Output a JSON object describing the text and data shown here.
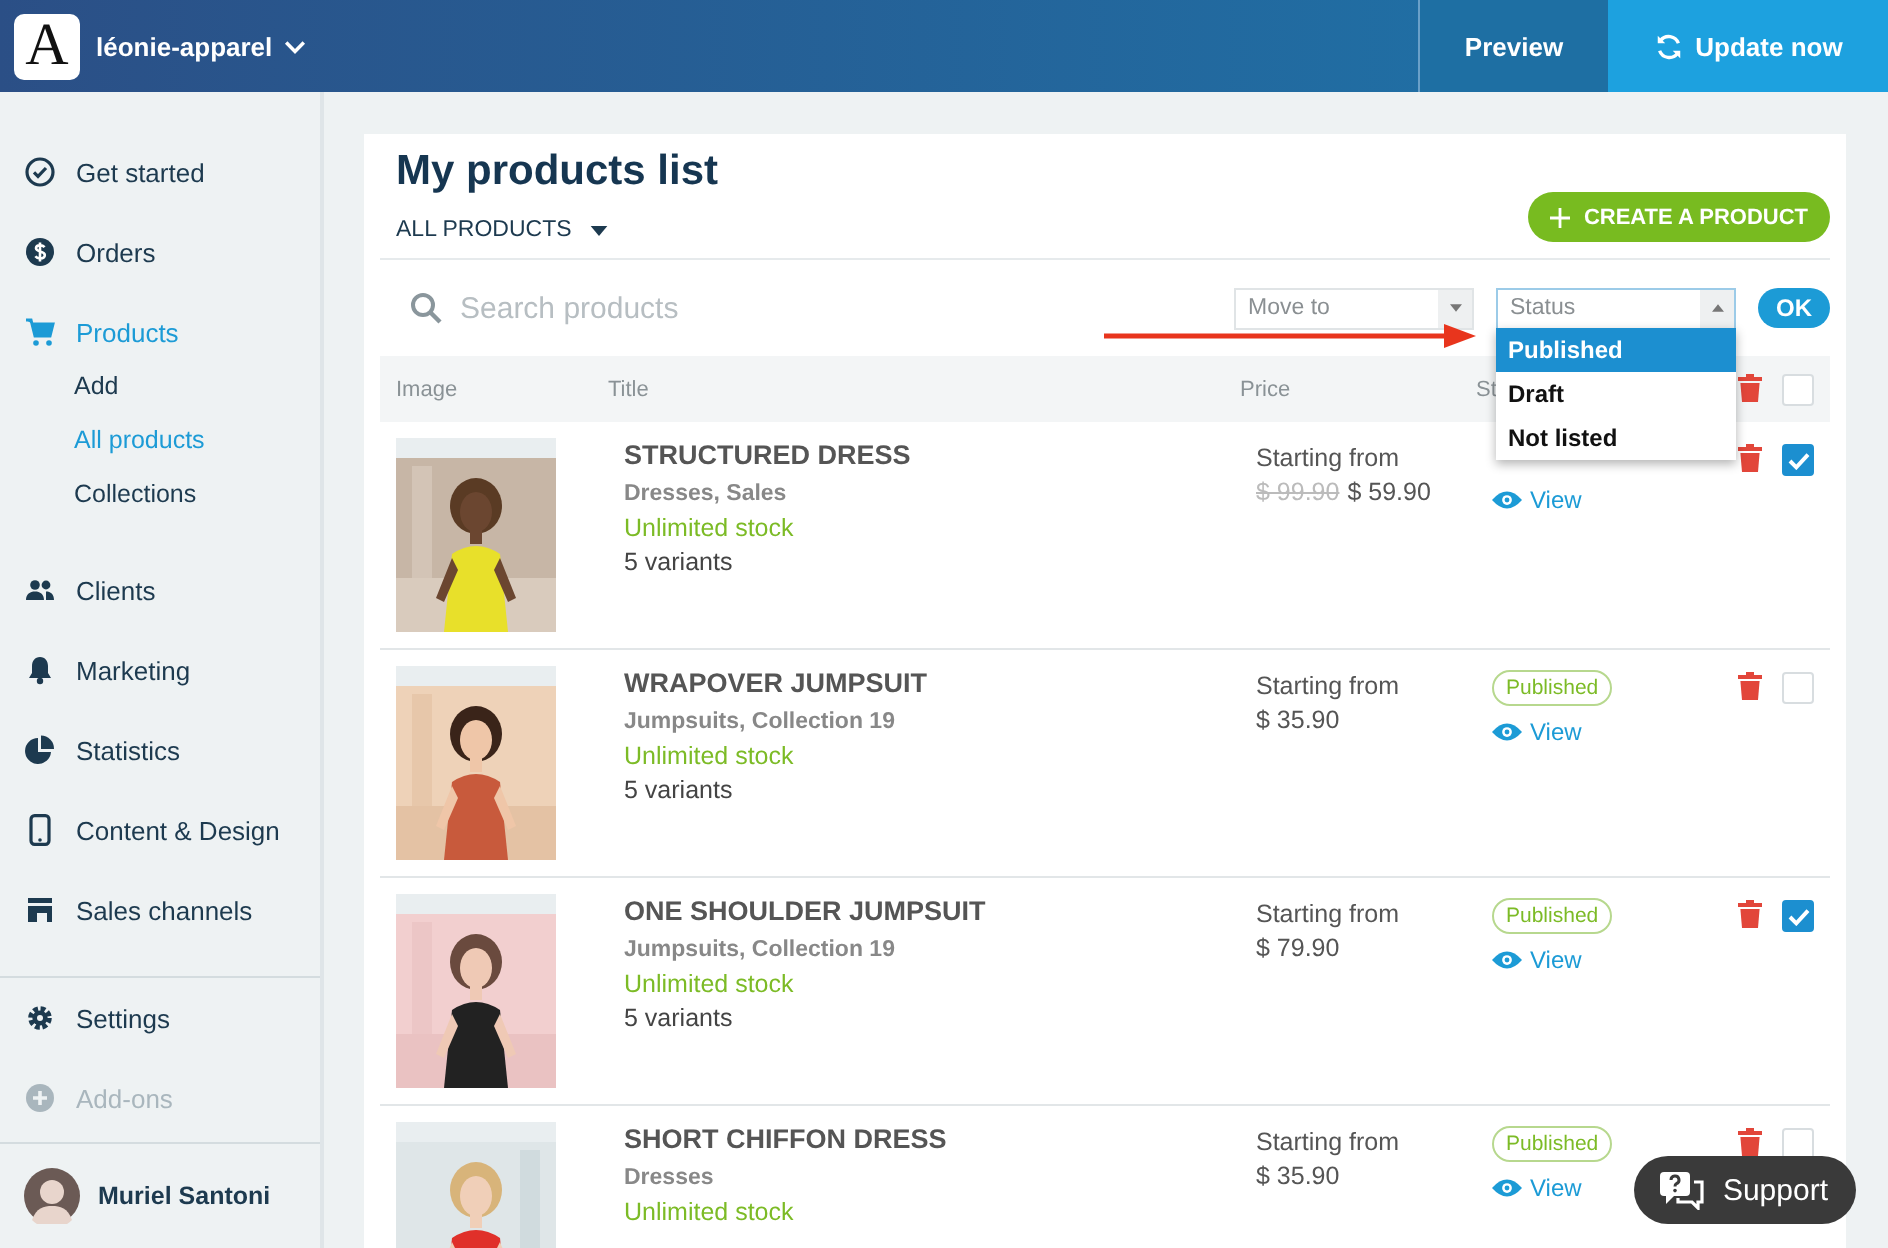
{
  "app": {
    "logo": "A",
    "store_name": "léonie-apparel"
  },
  "header_buttons": [
    {
      "label": "Preview",
      "kind": "plain"
    },
    {
      "label": "Update now",
      "kind": "primary"
    }
  ],
  "sidebar": {
    "items": [
      {
        "label": "Get started",
        "selected": false
      },
      {
        "label": "Orders",
        "selected": false
      },
      {
        "label": "Products",
        "selected": true,
        "children": [
          {
            "label": "Add",
            "selected": false
          },
          {
            "label": "All products",
            "selected": true
          },
          {
            "label": "Collections",
            "selected": false
          }
        ]
      },
      {
        "label": "Clients",
        "selected": false
      },
      {
        "label": "Marketing",
        "selected": false
      },
      {
        "label": "Statistics",
        "selected": false
      },
      {
        "label": "Content & Design",
        "selected": false
      },
      {
        "label": "Sales channels",
        "selected": false
      }
    ],
    "footer_items": [
      {
        "label": "Settings",
        "disabled": false
      },
      {
        "label": "Add-ons",
        "disabled": true
      }
    ],
    "user": "Muriel Santoni"
  },
  "page": {
    "title": "My products list",
    "filter": "ALL PRODUCTS",
    "create_button": "CREATE A PRODUCT"
  },
  "toolbar": {
    "search_placeholder": "Search products",
    "move_to": "Move to",
    "status_select": {
      "placeholder": "Status",
      "expanded": true,
      "options": [
        {
          "label": "Published",
          "selected": true
        },
        {
          "label": "Draft",
          "selected": false
        },
        {
          "label": "Not listed",
          "selected": false
        }
      ]
    },
    "ok": "OK"
  },
  "table": {
    "columns": [
      "Image",
      "Title",
      "Price",
      "St"
    ],
    "select_all": {
      "checked": false
    },
    "rows": [
      {
        "title": "STRUCTURED DRESS",
        "categories": "Dresses, Sales",
        "stock": "Unlimited stock",
        "variants": "5 variants",
        "price_label": "Starting from",
        "old_price": "$ 99.90",
        "sale_price": "$ 59.90",
        "view": "View",
        "checked": true
      },
      {
        "title": "WRAPOVER JUMPSUIT",
        "categories": "Jumpsuits, Collection 19",
        "stock": "Unlimited stock",
        "variants": "5 variants",
        "price_label": "Starting from",
        "price": "$ 35.90",
        "status": "Published",
        "view": "View",
        "checked": false
      },
      {
        "title": "ONE SHOULDER JUMPSUIT",
        "categories": "Jumpsuits, Collection 19",
        "stock": "Unlimited stock",
        "variants": "5 variants",
        "price_label": "Starting from",
        "price": "$ 79.90",
        "status": "Published",
        "view": "View",
        "checked": true
      },
      {
        "title": "SHORT CHIFFON DRESS",
        "categories": "Dresses",
        "stock": "Unlimited stock",
        "price_label": "Starting from",
        "price": "$ 35.90",
        "status": "Published",
        "view": "View",
        "checked": false
      }
    ]
  },
  "support": "Support"
}
